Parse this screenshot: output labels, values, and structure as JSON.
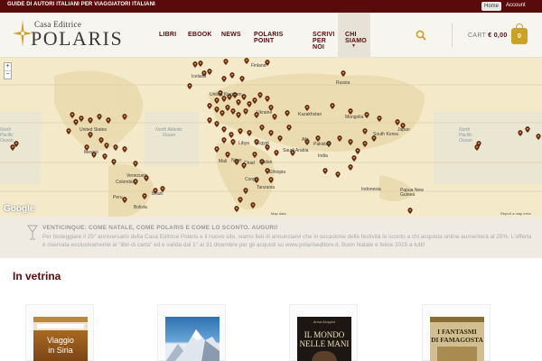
{
  "topbar": {
    "tagline": "GUIDE DI AUTORI ITALIANI PER VIAGGIATORI ITALIANI",
    "home": "Home",
    "account": "Account"
  },
  "logo": {
    "small": "Casa Editrice",
    "big": "POLARIS"
  },
  "nav": [
    "LIBRI",
    "EBOOK",
    "NEWS",
    "POLARIS POINT",
    "SCRIVI PER NOI",
    "CHI SIAMO"
  ],
  "cart": {
    "label": "CART",
    "amount": "€ 0,00",
    "count": "0"
  },
  "map": {
    "labels": {
      "finland": "Finland",
      "iceland": "Iceland",
      "russia": "Russia",
      "united_kingdom": "United Kingdom",
      "ukraine": "Ukraine",
      "kazakhstan": "Kazakhstan",
      "mongolia": "Mongolia",
      "united_states": "United States",
      "north_atlantic": "North Atlantic Ocean",
      "north_pacific_left": "North Pacific Ocean",
      "north_pacific_right": "North Pacific Ocean",
      "libya": "Libya",
      "egypt": "Egypt",
      "saudi_arabia": "Saudi Arabia",
      "pakistan": "Pakistan",
      "south_korea": "South Korea",
      "japan": "Japan",
      "india": "India",
      "mexico": "Mexico",
      "mali": "Mali",
      "niger": "Niger",
      "venezuela": "Venezuela",
      "colombia": "Colombia",
      "peru": "Peru",
      "brazil": "Brazil",
      "bolivia": "Bolivia",
      "tanzania": "Tanzania",
      "indonesia": "Indonesia",
      "papua": "Papua New Guinea",
      "afghanistan": "Afg",
      "chad": "Chad",
      "sudan": "Sudan",
      "ethiopia": "Ethiopia",
      "congo": "Congo"
    },
    "zoom_in": "+",
    "zoom_out": "−",
    "google": "Google",
    "mapdata": "Map data",
    "report": "Report a map error"
  },
  "notice": {
    "title": "VENTICINQUE: COME NATALE, COME POLARIS E COME LO SCONTO. AUGURI!",
    "body": "Per festeggiare il 25° anniversario della Casa Editrice Polaris e il nuovo sito, siamo lieti di annunciarvi che in occasione delle festività lo sconto a chi acquista online aumenterà al 25%. L'offerta è riservata esclusivamente ai \"libri di carta\" ed è valida dal 1° al 31 dicembre per gli acquisti su www.polariseditore.it. Buon Natale e felice 2015 a tutti!"
  },
  "section_title": "In vetrina",
  "books": [
    {
      "title_line1": "Viaggio",
      "title_line2": "in Siria"
    },
    {
      "title_line1": "",
      "title_line2": ""
    },
    {
      "author": "Anna Aloppini",
      "title_line1": "IL MONDO",
      "title_line2": "NELLE MANI"
    },
    {
      "title_line1": "I FANTASMI",
      "title_line2": "DI FAMAGOSTA"
    }
  ],
  "colors": {
    "brand": "#5a0a0a",
    "gold": "#c9a227",
    "map_land": "#f2e4bf",
    "pin": "#6b2a10"
  },
  "icons": [
    "logo-star-icon",
    "search-icon",
    "cart-bag-icon",
    "wine-glass-icon",
    "map-pin-icon"
  ]
}
